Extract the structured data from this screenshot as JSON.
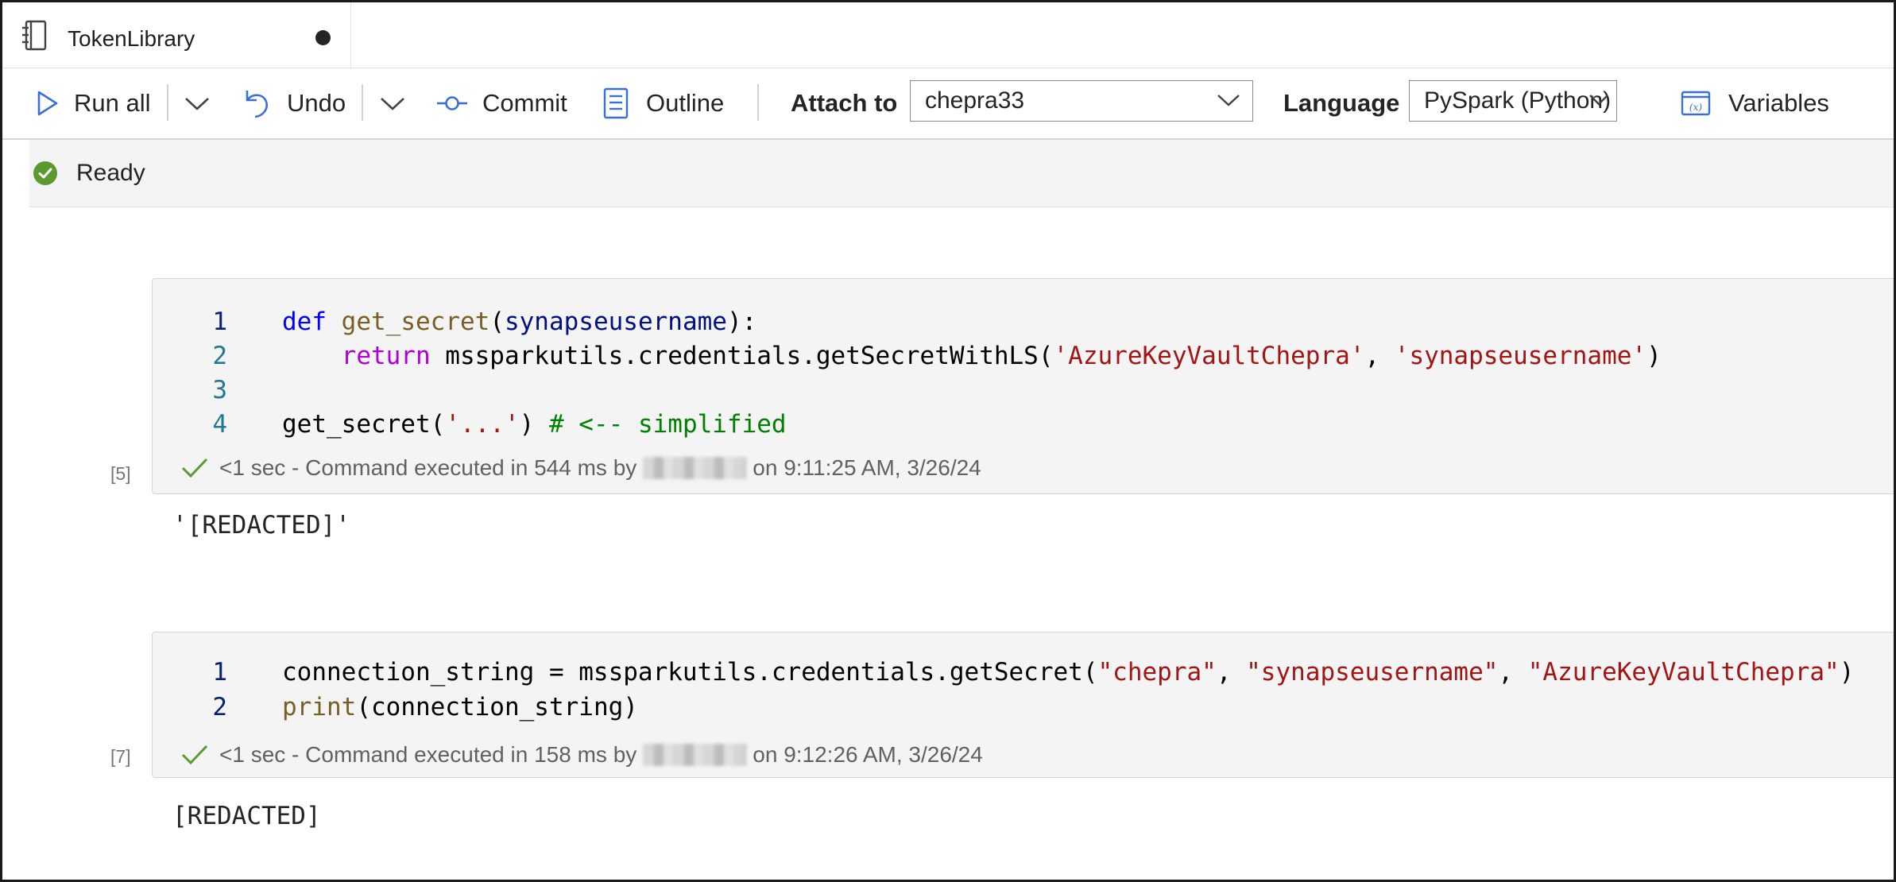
{
  "tab": {
    "title": "TokenLibrary",
    "icon": "notebook-icon",
    "dirty_indicator": "unsaved-dot"
  },
  "toolbar": {
    "run_all": "Run all",
    "undo": "Undo",
    "commit": "Commit",
    "outline": "Outline",
    "attach_to_label": "Attach to",
    "attach_to_value": "chepra33",
    "language_label": "Language",
    "language_value": "PySpark (Python)",
    "variables": "Variables"
  },
  "status": {
    "text": "Ready",
    "color": "#5b9a2f"
  },
  "cells": [
    {
      "exec_count": "[5]",
      "lines": [
        {
          "n": "1",
          "tokens": [
            [
              "kw-def",
              "def"
            ],
            [
              "plain",
              " "
            ],
            [
              "fn",
              "get_secret"
            ],
            [
              "plain",
              "("
            ],
            [
              "param",
              "synapseusername"
            ],
            [
              "plain",
              "):"
            ]
          ]
        },
        {
          "n": "2",
          "tokens": [
            [
              "plain",
              "    "
            ],
            [
              "kw-ret",
              "return"
            ],
            [
              "plain",
              " mssparkutils.credentials.getSecretWithLS("
            ],
            [
              "str",
              "'AzureKeyVaultChepra'"
            ],
            [
              "plain",
              ", "
            ],
            [
              "str",
              "'synapseusername'"
            ],
            [
              "plain",
              ")"
            ]
          ]
        },
        {
          "n": "3",
          "tokens": []
        },
        {
          "n": "4",
          "tokens": [
            [
              "plain",
              "get_secret("
            ],
            [
              "str",
              "'...'"
            ],
            [
              "plain",
              ") "
            ],
            [
              "cmt",
              "# <-- simplified"
            ]
          ]
        }
      ],
      "exec_prefix": "<1 sec - Command executed in 544 ms by",
      "exec_suffix": "on 9:11:25 AM, 3/26/24",
      "output": "'[REDACTED]'"
    },
    {
      "exec_count": "[7]",
      "lines": [
        {
          "n": "1",
          "tokens": [
            [
              "plain",
              "connection_string = mssparkutils.credentials.getSecret("
            ],
            [
              "str",
              "\"chepra\""
            ],
            [
              "plain",
              ", "
            ],
            [
              "str",
              "\"synapseusername\""
            ],
            [
              "plain",
              ", "
            ],
            [
              "str",
              "\"AzureKeyVaultChepra\""
            ],
            [
              "plain",
              ")"
            ]
          ]
        },
        {
          "n": "2",
          "tokens": [
            [
              "fn",
              "print"
            ],
            [
              "plain",
              "(connection_string)"
            ]
          ]
        }
      ],
      "exec_prefix": "<1 sec - Command executed in 158 ms by",
      "exec_suffix": "on 9:12:26 AM, 3/26/24",
      "output": "[REDACTED]"
    }
  ]
}
